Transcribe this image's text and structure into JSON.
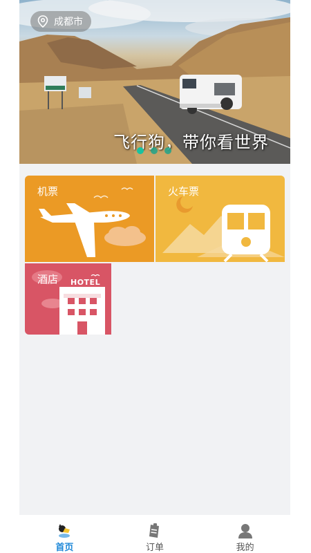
{
  "banner": {
    "location": "成都市",
    "slogan": "飞行狗，带你看世界",
    "slide_count": 3,
    "active_slide": 1
  },
  "services": [
    {
      "label": "机票",
      "color": "#eb9a25",
      "icon": "airplane-icon"
    },
    {
      "label": "火车票",
      "color": "#f1b83f",
      "icon": "train-icon"
    },
    {
      "label": "酒店",
      "color": "#d85565",
      "icon": "hotel-icon",
      "sign": "HOTEL"
    }
  ],
  "tabbar": {
    "items": [
      {
        "label": "首页",
        "icon": "home-dog-icon",
        "active": true
      },
      {
        "label": "订单",
        "icon": "order-icon",
        "active": false
      },
      {
        "label": "我的",
        "icon": "profile-icon",
        "active": false
      }
    ],
    "active_color": "#1e88d8"
  }
}
